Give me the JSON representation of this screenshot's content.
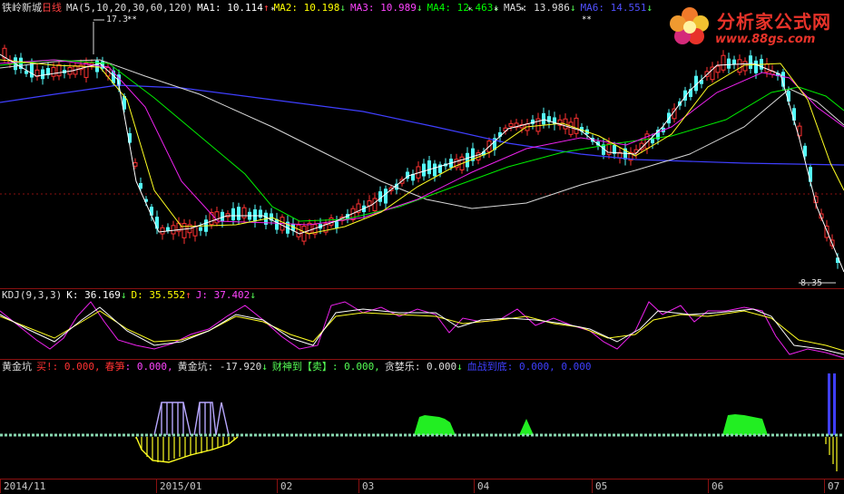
{
  "colors": {
    "up": "#ff3232",
    "down": "#54fcfc",
    "ma1": "#ffffff",
    "ma2": "#ffff00",
    "ma3": "#ff00ff",
    "ma4": "#00ff00",
    "ma5": "#c0c0c0",
    "ma6": "#3f3fff",
    "grid": "#8a1010"
  },
  "main": {
    "stock_name": "铁岭新城",
    "period": "日线",
    "ma_params": "MA(5,10,20,30,60,120)",
    "ma1_label": "MA1: 10.114",
    "ma1_arrow": "↑",
    "ma2_label": "MA2: 10.198",
    "ma2_arrow": "↓",
    "ma3_label": "MA3: 10.989",
    "ma3_arrow": "↓",
    "ma4_label": "MA4: 12.463",
    "ma4_arrow": "↓",
    "ma5_label": "MA5: 13.986",
    "ma5_arrow": "↓",
    "ma6_label": "MA6: 14.551",
    "ma6_arrow": "↓",
    "high_price": "17.3",
    "low_price": "8.35"
  },
  "kdj": {
    "name": "KDJ(9,3,3)",
    "k_label": "K: 36.169",
    "k_arrow": "↓",
    "d_label": "D: 35.552",
    "d_arrow": "↑",
    "j_label": "J: 37.402",
    "j_arrow": "↓"
  },
  "indicator": {
    "name": "黄金坑",
    "buy_label": "买!",
    "buy_value": ": 0.000,",
    "spring_label": "春笋",
    "spring_value": ": 0.000,",
    "pit_label": "黄金坑",
    "pit_value": ": -17.920",
    "pit_arrow": "↓",
    "fortune_label": "财神到【卖】",
    "fortune_value": ": 0.000,",
    "greedy_label": "贪婪乐",
    "greedy_value": ": 0.000",
    "greedy_arrow": "↓",
    "blood_label": "血战到底",
    "blood_value": ": 0.000, 0.000"
  },
  "logo": {
    "title": "分析家公式网",
    "url": "www.88gs.com"
  },
  "x_axis": [
    "2014/11",
    "2015/01",
    "02",
    "03",
    "04",
    "05",
    "06",
    "07"
  ]
}
